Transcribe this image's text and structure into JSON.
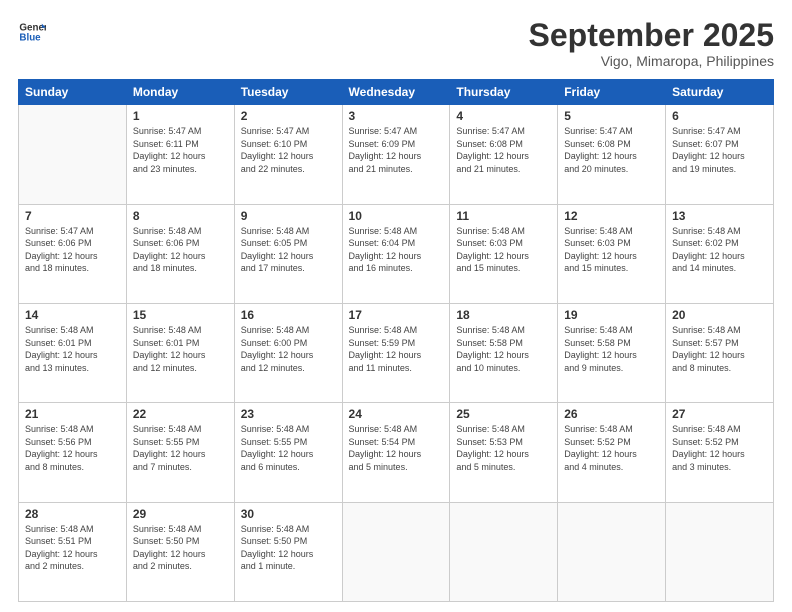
{
  "header": {
    "logo_line1": "General",
    "logo_line2": "Blue",
    "month": "September 2025",
    "location": "Vigo, Mimaropa, Philippines"
  },
  "weekdays": [
    "Sunday",
    "Monday",
    "Tuesday",
    "Wednesday",
    "Thursday",
    "Friday",
    "Saturday"
  ],
  "weeks": [
    [
      {
        "day": "",
        "info": ""
      },
      {
        "day": "1",
        "info": "Sunrise: 5:47 AM\nSunset: 6:11 PM\nDaylight: 12 hours\nand 23 minutes."
      },
      {
        "day": "2",
        "info": "Sunrise: 5:47 AM\nSunset: 6:10 PM\nDaylight: 12 hours\nand 22 minutes."
      },
      {
        "day": "3",
        "info": "Sunrise: 5:47 AM\nSunset: 6:09 PM\nDaylight: 12 hours\nand 21 minutes."
      },
      {
        "day": "4",
        "info": "Sunrise: 5:47 AM\nSunset: 6:08 PM\nDaylight: 12 hours\nand 21 minutes."
      },
      {
        "day": "5",
        "info": "Sunrise: 5:47 AM\nSunset: 6:08 PM\nDaylight: 12 hours\nand 20 minutes."
      },
      {
        "day": "6",
        "info": "Sunrise: 5:47 AM\nSunset: 6:07 PM\nDaylight: 12 hours\nand 19 minutes."
      }
    ],
    [
      {
        "day": "7",
        "info": "Sunrise: 5:47 AM\nSunset: 6:06 PM\nDaylight: 12 hours\nand 18 minutes."
      },
      {
        "day": "8",
        "info": "Sunrise: 5:48 AM\nSunset: 6:06 PM\nDaylight: 12 hours\nand 18 minutes."
      },
      {
        "day": "9",
        "info": "Sunrise: 5:48 AM\nSunset: 6:05 PM\nDaylight: 12 hours\nand 17 minutes."
      },
      {
        "day": "10",
        "info": "Sunrise: 5:48 AM\nSunset: 6:04 PM\nDaylight: 12 hours\nand 16 minutes."
      },
      {
        "day": "11",
        "info": "Sunrise: 5:48 AM\nSunset: 6:03 PM\nDaylight: 12 hours\nand 15 minutes."
      },
      {
        "day": "12",
        "info": "Sunrise: 5:48 AM\nSunset: 6:03 PM\nDaylight: 12 hours\nand 15 minutes."
      },
      {
        "day": "13",
        "info": "Sunrise: 5:48 AM\nSunset: 6:02 PM\nDaylight: 12 hours\nand 14 minutes."
      }
    ],
    [
      {
        "day": "14",
        "info": "Sunrise: 5:48 AM\nSunset: 6:01 PM\nDaylight: 12 hours\nand 13 minutes."
      },
      {
        "day": "15",
        "info": "Sunrise: 5:48 AM\nSunset: 6:01 PM\nDaylight: 12 hours\nand 12 minutes."
      },
      {
        "day": "16",
        "info": "Sunrise: 5:48 AM\nSunset: 6:00 PM\nDaylight: 12 hours\nand 12 minutes."
      },
      {
        "day": "17",
        "info": "Sunrise: 5:48 AM\nSunset: 5:59 PM\nDaylight: 12 hours\nand 11 minutes."
      },
      {
        "day": "18",
        "info": "Sunrise: 5:48 AM\nSunset: 5:58 PM\nDaylight: 12 hours\nand 10 minutes."
      },
      {
        "day": "19",
        "info": "Sunrise: 5:48 AM\nSunset: 5:58 PM\nDaylight: 12 hours\nand 9 minutes."
      },
      {
        "day": "20",
        "info": "Sunrise: 5:48 AM\nSunset: 5:57 PM\nDaylight: 12 hours\nand 8 minutes."
      }
    ],
    [
      {
        "day": "21",
        "info": "Sunrise: 5:48 AM\nSunset: 5:56 PM\nDaylight: 12 hours\nand 8 minutes."
      },
      {
        "day": "22",
        "info": "Sunrise: 5:48 AM\nSunset: 5:55 PM\nDaylight: 12 hours\nand 7 minutes."
      },
      {
        "day": "23",
        "info": "Sunrise: 5:48 AM\nSunset: 5:55 PM\nDaylight: 12 hours\nand 6 minutes."
      },
      {
        "day": "24",
        "info": "Sunrise: 5:48 AM\nSunset: 5:54 PM\nDaylight: 12 hours\nand 5 minutes."
      },
      {
        "day": "25",
        "info": "Sunrise: 5:48 AM\nSunset: 5:53 PM\nDaylight: 12 hours\nand 5 minutes."
      },
      {
        "day": "26",
        "info": "Sunrise: 5:48 AM\nSunset: 5:52 PM\nDaylight: 12 hours\nand 4 minutes."
      },
      {
        "day": "27",
        "info": "Sunrise: 5:48 AM\nSunset: 5:52 PM\nDaylight: 12 hours\nand 3 minutes."
      }
    ],
    [
      {
        "day": "28",
        "info": "Sunrise: 5:48 AM\nSunset: 5:51 PM\nDaylight: 12 hours\nand 2 minutes."
      },
      {
        "day": "29",
        "info": "Sunrise: 5:48 AM\nSunset: 5:50 PM\nDaylight: 12 hours\nand 2 minutes."
      },
      {
        "day": "30",
        "info": "Sunrise: 5:48 AM\nSunset: 5:50 PM\nDaylight: 12 hours\nand 1 minute."
      },
      {
        "day": "",
        "info": ""
      },
      {
        "day": "",
        "info": ""
      },
      {
        "day": "",
        "info": ""
      },
      {
        "day": "",
        "info": ""
      }
    ]
  ]
}
